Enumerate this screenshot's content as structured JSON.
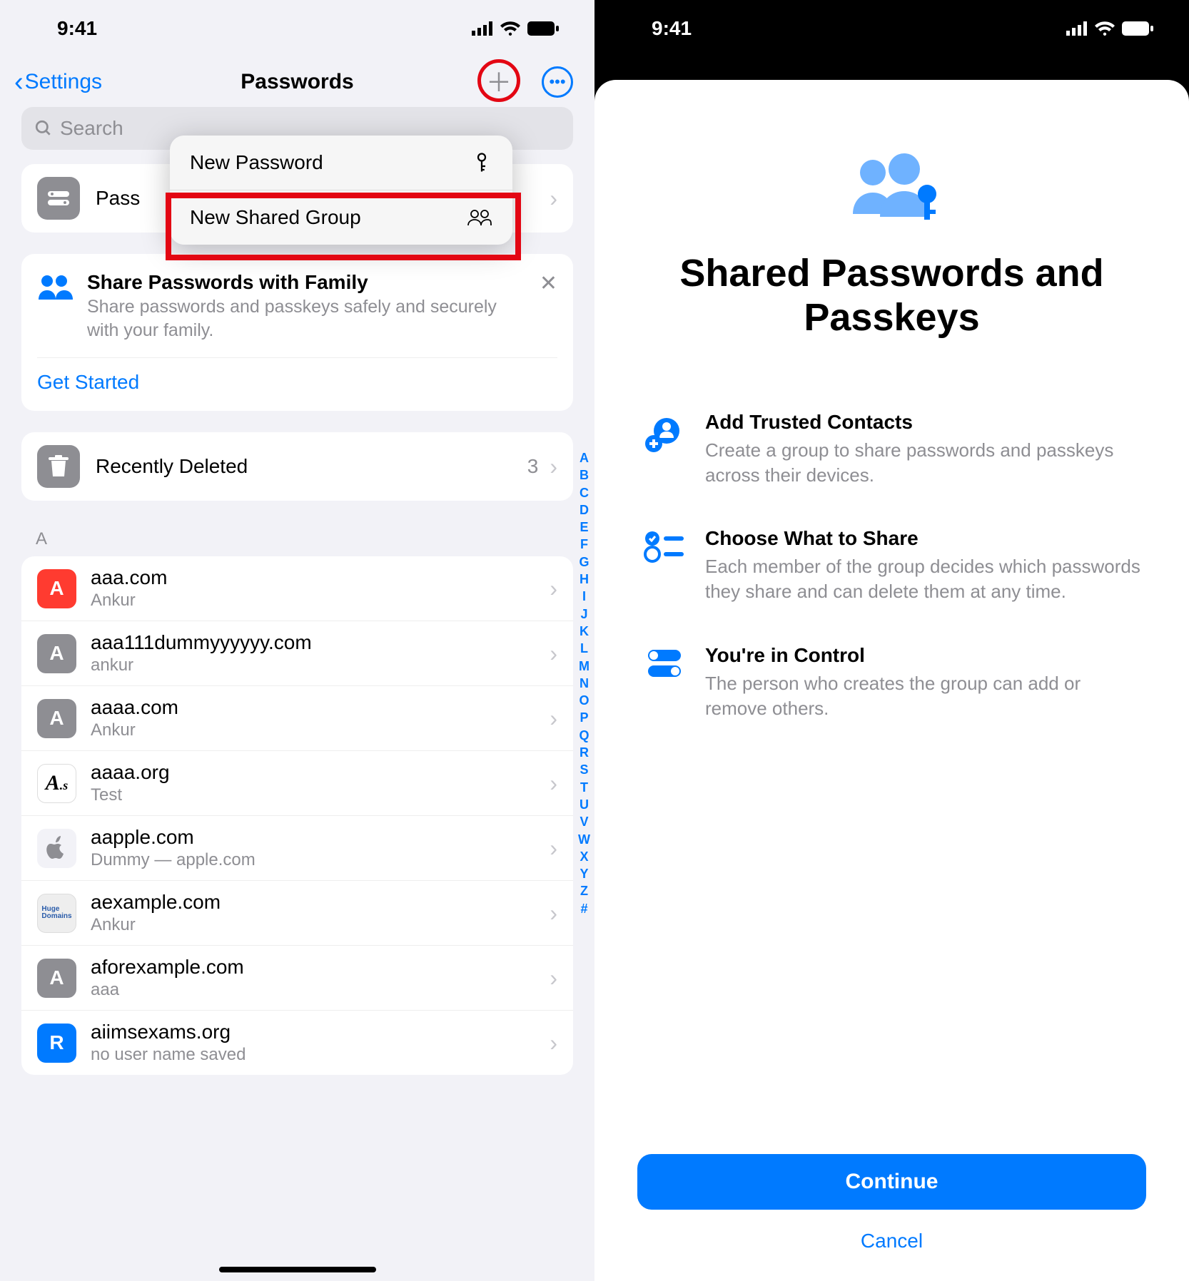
{
  "status": {
    "time": "9:41"
  },
  "nav": {
    "back": "Settings",
    "title": "Passwords"
  },
  "search": {
    "placeholder": "Search"
  },
  "dropdown": {
    "new_password": "New Password",
    "new_shared_group": "New Shared Group"
  },
  "passkeys_row": "Pass",
  "family": {
    "title": "Share Passwords with Family",
    "subtitle": "Share passwords and passkeys safely and securely with your family.",
    "cta": "Get Started"
  },
  "recently_deleted": {
    "label": "Recently Deleted",
    "count": "3"
  },
  "section_a": "A",
  "index_letters": [
    "A",
    "B",
    "C",
    "D",
    "E",
    "F",
    "G",
    "H",
    "I",
    "J",
    "K",
    "L",
    "M",
    "N",
    "O",
    "P",
    "Q",
    "R",
    "S",
    "T",
    "U",
    "V",
    "W",
    "X",
    "Y",
    "Z",
    "#"
  ],
  "passwords": [
    {
      "letter": "A",
      "bg": "#ff3b30",
      "site": "aaa.com",
      "user": "Ankur"
    },
    {
      "letter": "A",
      "bg": "#8e8e93",
      "site": "aaa111dummyyyyyy.com",
      "user": "ankur"
    },
    {
      "letter": "A",
      "bg": "#8e8e93",
      "site": "aaaa.com",
      "user": "Ankur"
    },
    {
      "letter": "A_S",
      "bg": "#ffffff",
      "site": "aaaa.org",
      "user": "Test"
    },
    {
      "letter": "",
      "bg": "#f2f2f7",
      "site": "aapple.com",
      "user": "Dummy — apple.com"
    },
    {
      "letter": "HD",
      "bg": "#eeeeee",
      "site": "aexample.com",
      "user": "Ankur"
    },
    {
      "letter": "A",
      "bg": "#8e8e93",
      "site": "aforexample.com",
      "user": "aaa"
    },
    {
      "letter": "R",
      "bg": "#007aff",
      "site": "aiimsexams.org",
      "user": "no user name saved"
    }
  ],
  "sheet": {
    "title": "Shared Passwords and Passkeys",
    "features": [
      {
        "title": "Add Trusted Contacts",
        "body": "Create a group to share passwords and passkeys across their devices."
      },
      {
        "title": "Choose What to Share",
        "body": "Each member of the group decides which passwords they share and can delete them at any time."
      },
      {
        "title": "You're in Control",
        "body": "The person who creates the group can add or remove others."
      }
    ],
    "continue": "Continue",
    "cancel": "Cancel"
  }
}
